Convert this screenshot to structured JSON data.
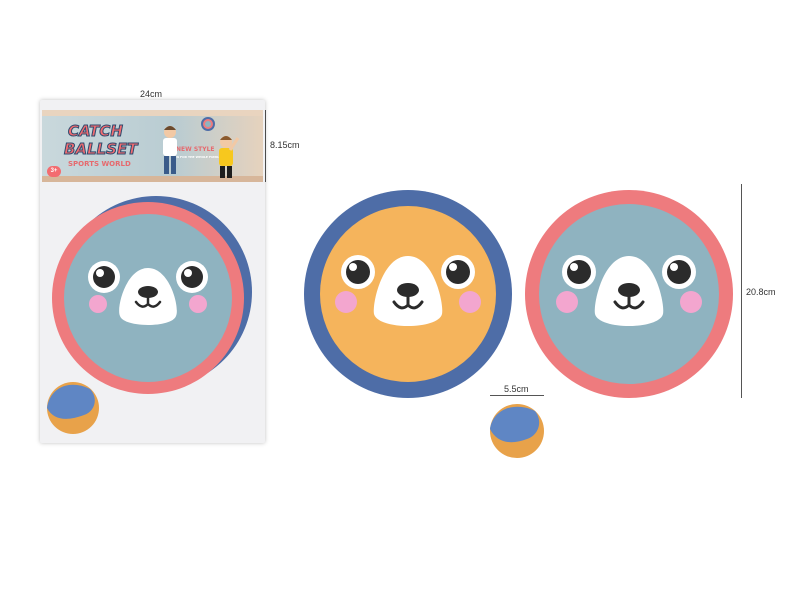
{
  "dimensions": {
    "package_width": "24cm",
    "package_height": "8.15cm",
    "ball_diameter": "5.5cm",
    "paddle_diameter": "20.8cm"
  },
  "package": {
    "title_line1": "CATCH",
    "title_line2": "BALLSET",
    "subtitle": "SPORTS WORLD",
    "tagline": "NEW STYLE",
    "small_print": "FUN FOR THE WHOLE FAMILY",
    "age_badge": "3+"
  },
  "colors": {
    "blue_rim": "#4e6da7",
    "pink_rim": "#ee7b7e",
    "blue_face": "#8fb3c0",
    "orange_face": "#f5b45c",
    "cheek": "#f3a6cf",
    "muzzle": "#ffffff",
    "eye": "#2b2b2b"
  }
}
